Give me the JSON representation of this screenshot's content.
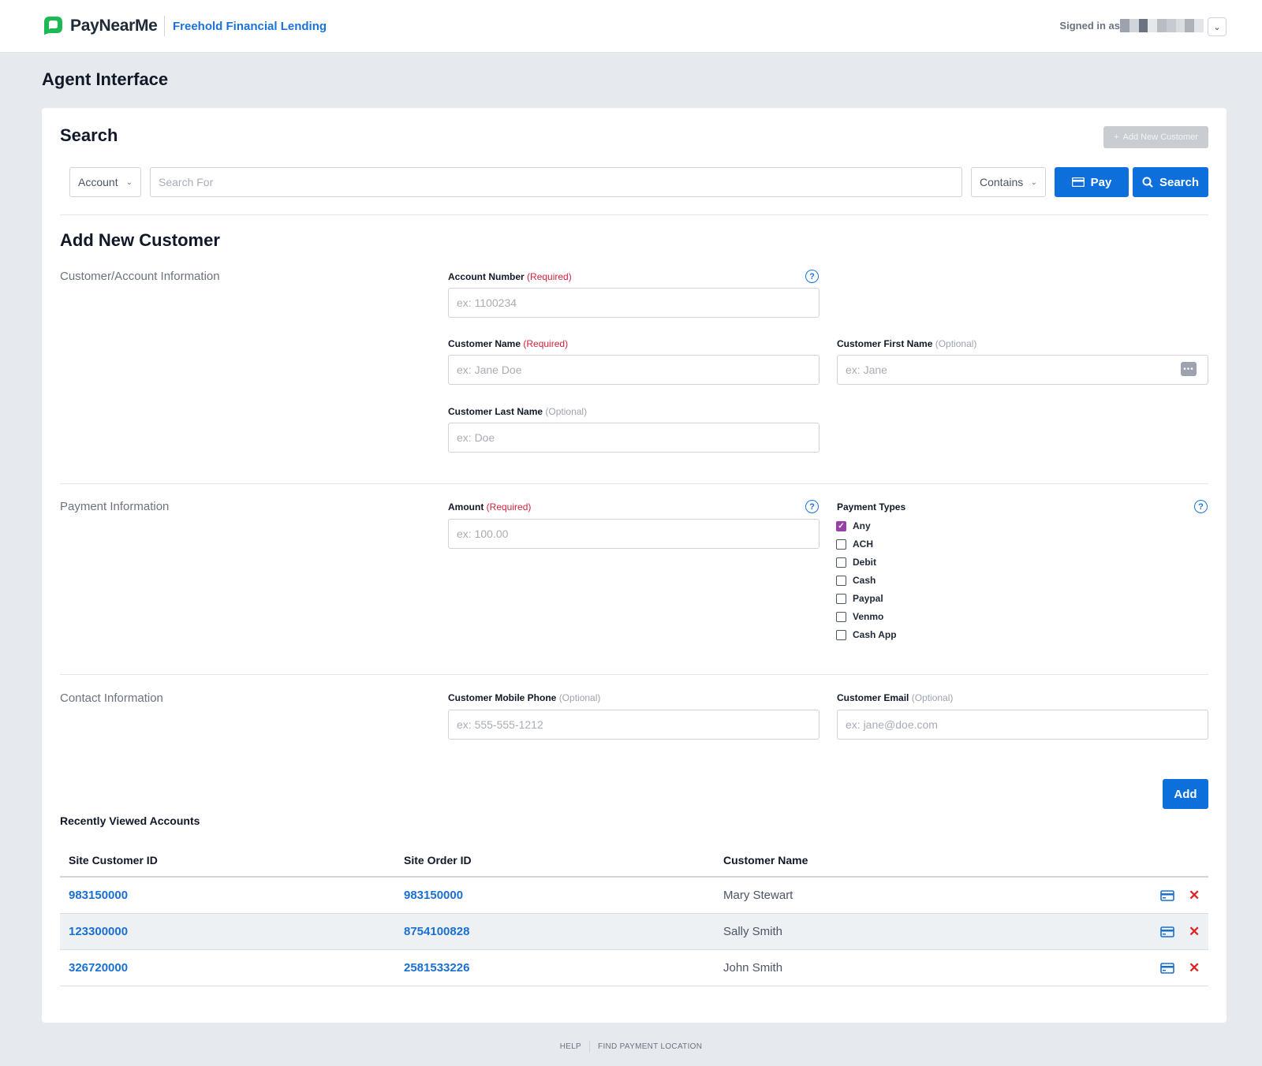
{
  "header": {
    "brand": "PayNearMe",
    "organization": "Freehold Financial Lending",
    "signed_in_label": "Signed in as",
    "brand_color": "#1db954",
    "link_color": "#1a73d9"
  },
  "page_title": "Agent Interface",
  "search": {
    "title": "Search",
    "add_new_customer_label": "Add New Customer",
    "field_select": "Account",
    "query_placeholder": "Search For",
    "match_select": "Contains",
    "pay_label": "Pay",
    "search_label": "Search"
  },
  "add_customer": {
    "title": "Add New Customer",
    "sections": {
      "customer_account": "Customer/Account Information",
      "payment": "Payment Information",
      "contact": "Contact Information"
    },
    "required_tag": "(Required)",
    "optional_tag": "(Optional)",
    "fields": {
      "account_number": {
        "label": "Account Number",
        "placeholder": "ex: 1100234"
      },
      "customer_name": {
        "label": "Customer Name",
        "placeholder": "ex: Jane Doe"
      },
      "first_name": {
        "label": "Customer First Name",
        "placeholder": "ex: Jane"
      },
      "last_name": {
        "label": "Customer Last Name",
        "placeholder": "ex: Doe"
      },
      "amount": {
        "label": "Amount",
        "placeholder": "ex: 100.00"
      },
      "mobile_phone": {
        "label": "Customer Mobile Phone",
        "placeholder": "ex: 555-555-1212"
      },
      "email": {
        "label": "Customer Email",
        "placeholder": "ex: jane@doe.com"
      }
    },
    "payment_types": {
      "label": "Payment Types",
      "options": [
        {
          "label": "Any",
          "checked": true
        },
        {
          "label": "ACH",
          "checked": false
        },
        {
          "label": "Debit",
          "checked": false
        },
        {
          "label": "Cash",
          "checked": false
        },
        {
          "label": "Paypal",
          "checked": false
        },
        {
          "label": "Venmo",
          "checked": false
        },
        {
          "label": "Cash App",
          "checked": false
        }
      ]
    },
    "add_button": "Add"
  },
  "recent": {
    "title": "Recently Viewed Accounts",
    "columns": [
      "Site Customer ID",
      "Site Order ID",
      "Customer Name"
    ],
    "rows": [
      {
        "customer_id": "983150000",
        "order_id": "983150000",
        "name": "Mary Stewart"
      },
      {
        "customer_id": "123300000",
        "order_id": "8754100828",
        "name": "Sally Smith"
      },
      {
        "customer_id": "326720000",
        "order_id": "2581533226",
        "name": "John Smith"
      }
    ]
  },
  "footer": {
    "help": "HELP",
    "find_location": "FIND PAYMENT LOCATION"
  }
}
